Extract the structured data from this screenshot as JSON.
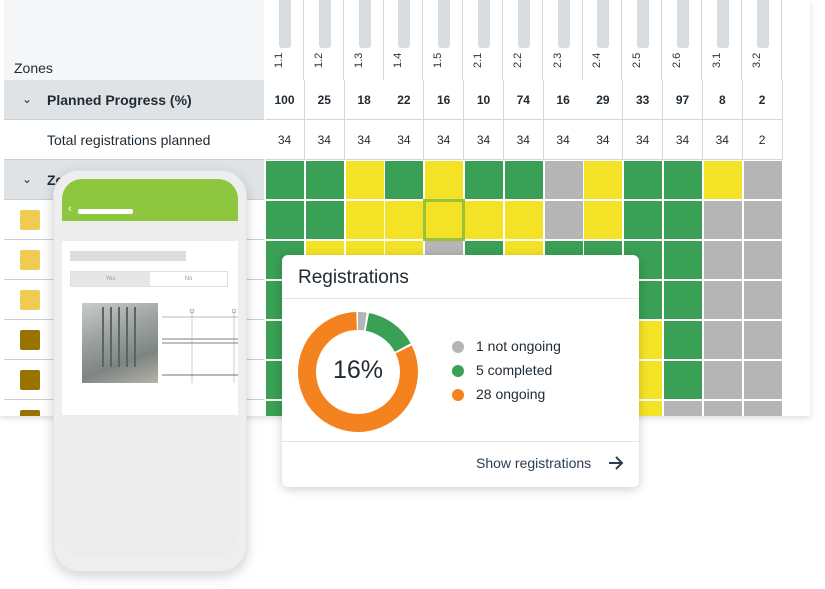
{
  "spreadsheet": {
    "zones_header": "Zones",
    "columns": [
      "1.1",
      "1.2",
      "1.3",
      "1.4",
      "1.5",
      "2.1",
      "2.2",
      "2.3",
      "2.4",
      "2.5",
      "2.6",
      "3.1",
      "3.2"
    ],
    "rows": {
      "planned_progress": {
        "label": "Planned Progress (%)",
        "values": [
          "100",
          "25",
          "18",
          "22",
          "16",
          "10",
          "74",
          "16",
          "29",
          "33",
          "97",
          "8",
          "2"
        ]
      },
      "total_registrations": {
        "label": "Total registrations planned",
        "values": [
          "34",
          "34",
          "34",
          "34",
          "34",
          "34",
          "34",
          "34",
          "34",
          "34",
          "34",
          "34",
          "2"
        ]
      },
      "zone_group": {
        "label": "Zo"
      }
    },
    "cell_status": [
      [
        "green",
        "green",
        "yellow",
        "green",
        "yellow",
        "green",
        "green",
        "gray",
        "yellow",
        "green",
        "green",
        "yellow",
        "gray"
      ],
      [
        "green",
        "green",
        "yellow",
        "yellow",
        "yellow",
        "yellow",
        "yellow",
        "gray",
        "yellow",
        "green",
        "green",
        "gray",
        "gray"
      ],
      [
        "green",
        "yellow",
        "yellow",
        "yellow",
        "gray",
        "green",
        "yellow",
        "green",
        "green",
        "green",
        "green",
        "gray",
        "gray"
      ],
      [
        "green",
        "yellow",
        "yellow",
        "yellow",
        "gray",
        "green",
        "yellow",
        "green",
        "green",
        "green",
        "green",
        "gray",
        "gray"
      ],
      [
        "green",
        "yellow",
        "yellow",
        "yellow",
        "gray",
        "green",
        "yellow",
        "green",
        "yellow",
        "yellow",
        "green",
        "gray",
        "gray"
      ],
      [
        "green",
        "yellow",
        "yellow",
        "yellow",
        "gray",
        "green",
        "yellow",
        "green",
        "yellow",
        "yellow",
        "green",
        "gray",
        "gray"
      ],
      [
        "green",
        "yellow",
        "yellow",
        "yellow",
        "gray",
        "green",
        "yellow",
        "green",
        "gray",
        "yellow",
        "gray",
        "gray",
        "gray"
      ]
    ],
    "swatch_colors": [
      "#f0cc55",
      "#f0cc55",
      "#f0cc55",
      "#9a7200",
      "#9a7200",
      "#9a7200"
    ],
    "status_colors": {
      "green": "#3aa055",
      "yellow": "#f4e227",
      "gray": "#b5b5b5"
    }
  },
  "phone": {
    "toggle_yes": "Yes",
    "toggle_no": "No"
  },
  "registrations_card": {
    "title": "Registrations",
    "percent": "16%",
    "legend": [
      {
        "label": "1 not ongoing",
        "color": "#b5b5b5",
        "icon": "gray-dot-icon"
      },
      {
        "label": "5 completed",
        "color": "#3aa055",
        "icon": "green-dot-icon"
      },
      {
        "label": "28 ongoing",
        "color": "#f4821f",
        "icon": "orange-dot-icon"
      }
    ],
    "donut_values": {
      "not_ongoing": 1,
      "completed": 5,
      "ongoing": 28
    },
    "show_link": "Show registrations",
    "show_icon": "arrow-right-icon"
  }
}
